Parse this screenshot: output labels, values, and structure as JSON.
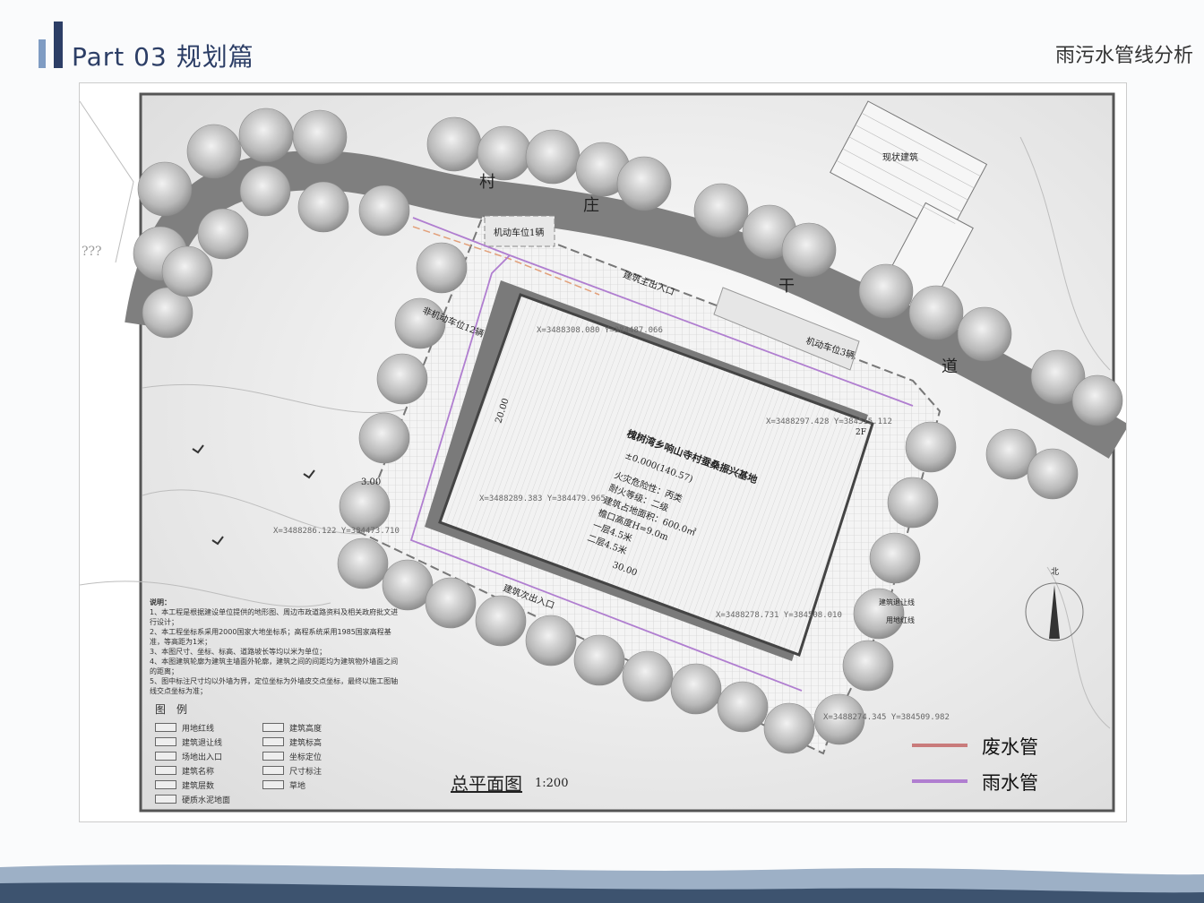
{
  "header": {
    "title": "Part 03  规划篇",
    "subtitle": "雨污水管线分析"
  },
  "map": {
    "road_chars": [
      "村",
      "庄",
      "干",
      "道"
    ],
    "existing_building": "现状建筑",
    "parking_1": "机动车位1辆",
    "parking_3": "机动车位3辆",
    "bike_parking": "非机动车位12辆",
    "main_entrance": "建筑主出入口",
    "secondary_entrance": "建筑次出入口",
    "building_name": "槐树湾乡响山寺村蚕桑振兴基地",
    "elevation": "±0.000(140.57)",
    "building_info": [
      "火灾危险性：丙类",
      "耐火等级：二级",
      "建筑占地面积：600.0㎡",
      "檐口高度H=9.0m",
      "一层4.5米",
      "二层4.5米"
    ],
    "floors": "2F",
    "dim_20": "20.00",
    "dim_30": "30.00",
    "dim_300": "3.00",
    "coords": [
      "X=3488308.080\nY=384487.066",
      "X=3488297.428\nY=384515.112",
      "X=3488289.383\nY=384479.965",
      "X=3488278.731\nY=384508.010",
      "X=3488286.122\nY=384473.710",
      "X=3488274.345\nY=384509.982"
    ],
    "question_marks": "???",
    "north_label": "北",
    "line_labels": [
      "建筑退让线",
      "用地红线"
    ],
    "caption_main": "总平面图",
    "caption_scale": "1:200"
  },
  "notes": {
    "title": "说明：",
    "items": [
      "1、本工程是根据建设单位提供的地形图、周边市政道路资料及相关政府批文进行设计；",
      "2、本工程坐标系采用2000国家大地坐标系；高程系统采用1985国家高程基准，等高距为1米；",
      "3、本图尺寸、坐标、标高、道路坡长等均以米为单位；",
      "4、本图建筑轮廓为建筑主墙面外轮廓，建筑之间的间距均为建筑物外墙面之间的距离；",
      "5、图中标注尺寸均以外墙为界，定位坐标为外墙皮交点坐标，最终以施工图轴线交点坐标为准；"
    ]
  },
  "symbol_legend": {
    "title": "图　例",
    "items": [
      "用地红线",
      "建筑高度",
      "建筑退让线",
      "建筑标高",
      "场地出入口",
      "坐标定位",
      "建筑名称",
      "尺寸标注",
      "建筑层数",
      "草地",
      "硬质水泥地面"
    ]
  },
  "legend": {
    "items": [
      {
        "label": "废水管",
        "color": "#c97b7b"
      },
      {
        "label": "雨水管",
        "color": "#b07ed0"
      }
    ]
  },
  "colors": {
    "accent": "#2c3e66",
    "accent_light": "#7f9cc3",
    "wastewater": "#c97b7b",
    "rainwater": "#b07ed0"
  }
}
